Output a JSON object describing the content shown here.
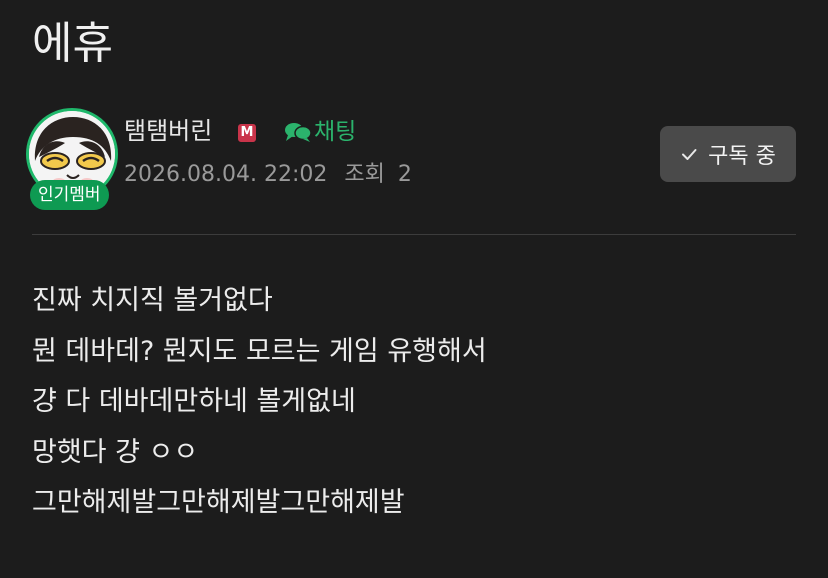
{
  "post": {
    "title": "에휴",
    "body_lines": [
      "진짜 치지직 볼거없다",
      "뭔 데바데? 뭔지도 모르는 게임 유행해서",
      "걍 다 데바데만하네 볼게없네",
      "망햇다 걍 ㅇㅇ",
      "그만해제발그만해제발그만해제발"
    ]
  },
  "author": {
    "name": "탬탬버린",
    "manager_badge": "M",
    "member_badge": "인기멤버",
    "avatar_icon": "avatar-image",
    "chat_label": "채팅",
    "chat_icon": "chat-bubbles-icon",
    "date": "2026.08.04. 22:02",
    "views_label": "조회",
    "views_count": "2"
  },
  "subscribe": {
    "label": "구독 중",
    "icon": "check-icon"
  },
  "colors": {
    "background": "#1c1c1c",
    "accent_green": "#2bb36c",
    "badge_green": "#0e9a52",
    "manager_red": "#c9344a",
    "button_bg": "#4a4a4a"
  }
}
